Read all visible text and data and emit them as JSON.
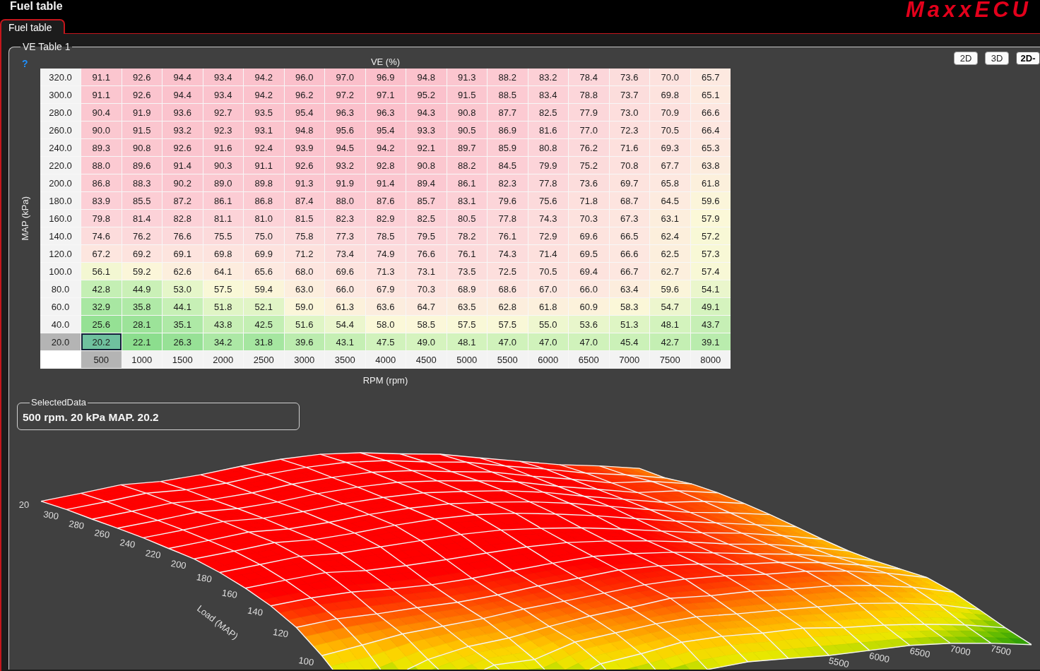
{
  "window": {
    "title": "Fuel table",
    "logo": "MaxxECU"
  },
  "tabs": [
    {
      "label": "Fuel table",
      "selected": true
    }
  ],
  "ve_table": {
    "title": "VE Table 1",
    "help": "?",
    "z_label": "VE (%)",
    "y_label": "MAP (kPa)",
    "x_label": "RPM (rpm)",
    "view_buttons": [
      {
        "label": "2D",
        "selected": false
      },
      {
        "label": "3D",
        "selected": false
      },
      {
        "label": "2D-",
        "selected": true
      }
    ],
    "rpm": [
      {
        "label": "500",
        "selected": true
      },
      {
        "label": "1000",
        "selected": false
      },
      {
        "label": "1500",
        "selected": false
      },
      {
        "label": "2000",
        "selected": false
      },
      {
        "label": "2500",
        "selected": false
      },
      {
        "label": "3000",
        "selected": false
      },
      {
        "label": "3500",
        "selected": false
      },
      {
        "label": "4000",
        "selected": false
      },
      {
        "label": "4500",
        "selected": false
      },
      {
        "label": "5000",
        "selected": false
      },
      {
        "label": "5500",
        "selected": false
      },
      {
        "label": "6000",
        "selected": false
      },
      {
        "label": "6500",
        "selected": false
      },
      {
        "label": "7000",
        "selected": false
      },
      {
        "label": "7500",
        "selected": false
      },
      {
        "label": "8000",
        "selected": false
      }
    ],
    "rows": [
      {
        "map": "320.0",
        "selected": false,
        "values": [
          "91.1",
          "92.6",
          "94.4",
          "93.4",
          "94.2",
          "96.0",
          "97.0",
          "96.9",
          "94.8",
          "91.3",
          "88.2",
          "83.2",
          "78.4",
          "73.6",
          "70.0",
          "65.7"
        ]
      },
      {
        "map": "300.0",
        "selected": false,
        "values": [
          "91.1",
          "92.6",
          "94.4",
          "93.4",
          "94.2",
          "96.2",
          "97.2",
          "97.1",
          "95.2",
          "91.5",
          "88.5",
          "83.4",
          "78.8",
          "73.7",
          "69.8",
          "65.1"
        ]
      },
      {
        "map": "280.0",
        "selected": false,
        "values": [
          "90.4",
          "91.9",
          "93.6",
          "92.7",
          "93.5",
          "95.4",
          "96.3",
          "96.3",
          "94.3",
          "90.8",
          "87.7",
          "82.5",
          "77.9",
          "73.0",
          "70.9",
          "66.6"
        ]
      },
      {
        "map": "260.0",
        "selected": false,
        "values": [
          "90.0",
          "91.5",
          "93.2",
          "92.3",
          "93.1",
          "94.8",
          "95.6",
          "95.4",
          "93.3",
          "90.5",
          "86.9",
          "81.6",
          "77.0",
          "72.3",
          "70.5",
          "66.4"
        ]
      },
      {
        "map": "240.0",
        "selected": false,
        "values": [
          "89.3",
          "90.8",
          "92.6",
          "91.6",
          "92.4",
          "93.9",
          "94.5",
          "94.2",
          "92.1",
          "89.7",
          "85.9",
          "80.8",
          "76.2",
          "71.6",
          "69.3",
          "65.3"
        ]
      },
      {
        "map": "220.0",
        "selected": false,
        "values": [
          "88.0",
          "89.6",
          "91.4",
          "90.3",
          "91.1",
          "92.6",
          "93.2",
          "92.8",
          "90.8",
          "88.2",
          "84.5",
          "79.9",
          "75.2",
          "70.8",
          "67.7",
          "63.8"
        ]
      },
      {
        "map": "200.0",
        "selected": false,
        "values": [
          "86.8",
          "88.3",
          "90.2",
          "89.0",
          "89.8",
          "91.3",
          "91.9",
          "91.4",
          "89.4",
          "86.1",
          "82.3",
          "77.8",
          "73.6",
          "69.7",
          "65.8",
          "61.8"
        ]
      },
      {
        "map": "180.0",
        "selected": false,
        "values": [
          "83.9",
          "85.5",
          "87.2",
          "86.1",
          "86.8",
          "87.4",
          "88.0",
          "87.6",
          "85.7",
          "83.1",
          "79.6",
          "75.6",
          "71.8",
          "68.7",
          "64.5",
          "59.6"
        ]
      },
      {
        "map": "160.0",
        "selected": false,
        "values": [
          "79.8",
          "81.4",
          "82.8",
          "81.1",
          "81.0",
          "81.5",
          "82.3",
          "82.9",
          "82.5",
          "80.5",
          "77.8",
          "74.3",
          "70.3",
          "67.3",
          "63.1",
          "57.9"
        ]
      },
      {
        "map": "140.0",
        "selected": false,
        "values": [
          "74.6",
          "76.2",
          "76.6",
          "75.5",
          "75.0",
          "75.8",
          "77.3",
          "78.5",
          "79.5",
          "78.2",
          "76.1",
          "72.9",
          "69.6",
          "66.5",
          "62.4",
          "57.2"
        ]
      },
      {
        "map": "120.0",
        "selected": false,
        "values": [
          "67.2",
          "69.2",
          "69.1",
          "69.8",
          "69.9",
          "71.2",
          "73.4",
          "74.9",
          "76.6",
          "76.1",
          "74.3",
          "71.4",
          "69.5",
          "66.6",
          "62.5",
          "57.3"
        ]
      },
      {
        "map": "100.0",
        "selected": false,
        "values": [
          "56.1",
          "59.2",
          "62.6",
          "64.1",
          "65.6",
          "68.0",
          "69.6",
          "71.3",
          "73.1",
          "73.5",
          "72.5",
          "70.5",
          "69.4",
          "66.7",
          "62.7",
          "57.4"
        ]
      },
      {
        "map": "80.0",
        "selected": false,
        "values": [
          "42.8",
          "44.9",
          "53.0",
          "57.5",
          "59.4",
          "63.0",
          "66.0",
          "67.9",
          "70.3",
          "68.9",
          "68.6",
          "67.0",
          "66.0",
          "63.4",
          "59.6",
          "54.1"
        ]
      },
      {
        "map": "60.0",
        "selected": false,
        "values": [
          "32.9",
          "35.8",
          "44.1",
          "51.8",
          "52.1",
          "59.0",
          "61.3",
          "63.6",
          "64.7",
          "63.5",
          "62.8",
          "61.8",
          "60.9",
          "58.3",
          "54.7",
          "49.1"
        ]
      },
      {
        "map": "40.0",
        "selected": false,
        "values": [
          "25.6",
          "28.1",
          "35.1",
          "43.8",
          "42.5",
          "51.6",
          "54.4",
          "58.0",
          "58.5",
          "57.5",
          "57.5",
          "55.0",
          "53.6",
          "51.3",
          "48.1",
          "43.7"
        ]
      },
      {
        "map": "20.0",
        "selected": true,
        "values": [
          "20.2",
          "22.1",
          "26.3",
          "34.2",
          "31.8",
          "39.6",
          "43.1",
          "47.5",
          "49.0",
          "48.1",
          "47.0",
          "47.0",
          "47.0",
          "45.4",
          "42.7",
          "39.1"
        ]
      }
    ]
  },
  "selected_data": {
    "title": "SelectedData",
    "text": "500 rpm. 20 kPa MAP. 20.2"
  },
  "surface_plot": {
    "corner_label": "20",
    "load_axis_title": "Load (MAP)",
    "load_ticks": [
      "300",
      "280",
      "260",
      "240",
      "220",
      "200",
      "180",
      "160",
      "140",
      "120",
      "100"
    ],
    "rpm_ticks": [
      "5500",
      "6000",
      "6500",
      "7000",
      "7500"
    ]
  }
}
